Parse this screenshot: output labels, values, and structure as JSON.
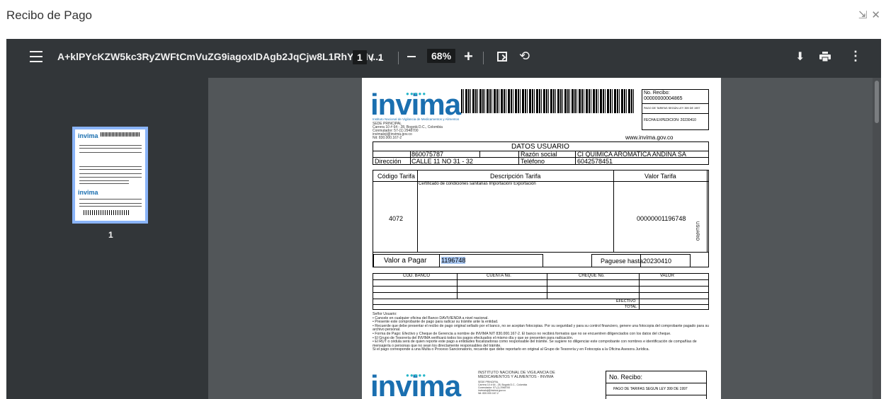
{
  "dialog": {
    "title": "Recibo de Pago",
    "controls": [
      "⇲",
      "✕"
    ]
  },
  "toolbar": {
    "file_name": "A+klPYcKZW5kc3RyZWFtCmVuZG9iagoxIDAgb2JqCjw8L1RhYnMv...",
    "current_page": "1",
    "page_sep": "/",
    "total_pages": "1",
    "zoom": "68%",
    "plus": "+",
    "rotate": "⟲",
    "download": "⬇",
    "more": "⋮"
  },
  "sidebar": {
    "thumbnail_label": "1"
  },
  "receipt": {
    "logo": "invima",
    "logo_sub": "Instituto Nacional de Vigilancia de Medicamentos y Alimentos",
    "sede": "SEDE PRINCIPAL",
    "address": "Carrera 10 # 64 - 28, Bogotá D.C., Colombia",
    "phone": "Conmutador: 57-(1) 2948700",
    "email": "invimaloji@invima.gov.co",
    "nit": "Nit: 830.000.167-2",
    "recibo_label": "No. Recibo:",
    "recibo_number": "00000000004865",
    "tarifas": "PAGO DE TARIFAS SEGÚN LEY 399 DE 1997",
    "fecha_expedicion": "FECHA EXPEDICION: 20230410",
    "website": "www.invima.gov.co",
    "datos_usuario": "DATOS USUARIO",
    "nit_value": "860075787",
    "razon_social_label": "Razón social",
    "razon_social": "CI QUIMICA AROMATICA ANDINA SA",
    "direccion_label": "Dirección",
    "direccion": "CALLE 11 NO 31 - 32",
    "telefono_label": "Teléfono",
    "telefono": "6042578451",
    "col_codigo": "Código Tarifa",
    "col_descripcion": "Descripción Tarifa",
    "col_valor": "Valor Tarifa",
    "codigo": "4072",
    "descripcion": "Certificado de condiciones sanitarias Importación/ Exportación",
    "valor": "00000001196748",
    "side_label": "USUARIO",
    "valor_pagar_label": "Valor a Pagar",
    "valor_pagar": "1196748",
    "paguese_label": "Paguese hasta",
    "paguese": "20230410",
    "cod_banco": "COD. BANCO",
    "cuenta": "CUENTA No.",
    "cheque": "CHEQUE No.",
    "valor_col": "VALOR",
    "efectivo": "EFECTIVO",
    "total": "TOTAL",
    "notes": [
      "Señor Usuario:",
      "• Cancele en cualquier oficina del Banco DAVIVIENDA a nivel nacional.",
      "• Presente este comprobante de pago para radicar su trámite ante la entidad.",
      "• Recuerde que debe presentar el recibo de pago original sellado por el banco, no se aceptan fotocopias. Por su seguridad y para su control financiero, genere una fotocopia del comprobante pagado para su archivo personal.",
      "• Forma de Pago: Efectivo y Cheque de Gerencia a nombre de INVIMA NIT 830.000.167-2. El banco no recibirá formatos que no se encuentren diligenciados con los datos del cheque.",
      "• El Grupo de Tesorería del INVIMA verificará todos los pagos efectuados el mismo día y que se presenten para radicación.",
      "• El RUT o cédula será de quien reporte este pago a entidades fiscalizadoras como responsable del trámite. Se sugiere no diligenciar este comprobante con nombres e identificación de compañías de mensajería o personas que no sean los directamente responsables del trámite.",
      "Si el pago corresponde a una Multa o Proceso Sancionatorio, recuerde que debe reportarlo en original al Grupo de Tesorería y en Fotocopia a la Oficina Asesora Jurídica."
    ],
    "copy_institute": "INSTITUTO NACIONAL DE VIGILANCIA DE MEDICAMENTOS Y ALIMENTOS - INVIMA",
    "copy_recibo_label": "No. Recibo:",
    "copy_tarifas": "PAGO DE TARIFAS SEGUN LEY 399 DE 1997"
  }
}
